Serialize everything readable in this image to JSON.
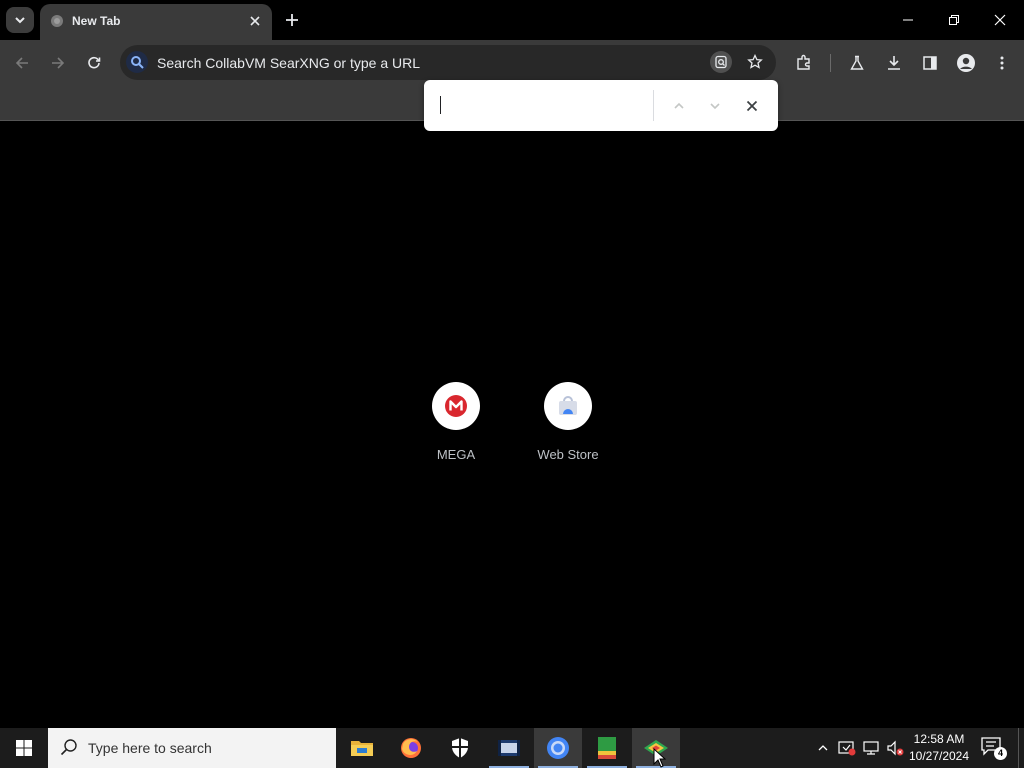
{
  "browser": {
    "tab": {
      "title": "New Tab"
    },
    "omnibox": {
      "placeholder": "Search CollabVM SearXNG or type a URL"
    }
  },
  "find_bar": {
    "value": ""
  },
  "shortcuts": [
    {
      "label": "MEGA",
      "icon": "mega-icon"
    },
    {
      "label": "Web Store",
      "icon": "web-store-icon"
    }
  ],
  "taskbar": {
    "search_placeholder": "Type here to search",
    "apps": [
      "file-explorer-icon",
      "firefox-icon",
      "security-shield-icon",
      "video-app-icon",
      "chrome-icon",
      "notebook-app-icon",
      "rainbow-app-icon"
    ],
    "clock": {
      "time": "12:58 AM",
      "date": "10/27/2024"
    },
    "notification_count": "4"
  },
  "colors": {
    "toolbar": "#3a3a3a",
    "background": "#000000",
    "taskbar": "#1c1c1c",
    "mega_red": "#d9272e",
    "chrome_blue": "#4285f4"
  }
}
